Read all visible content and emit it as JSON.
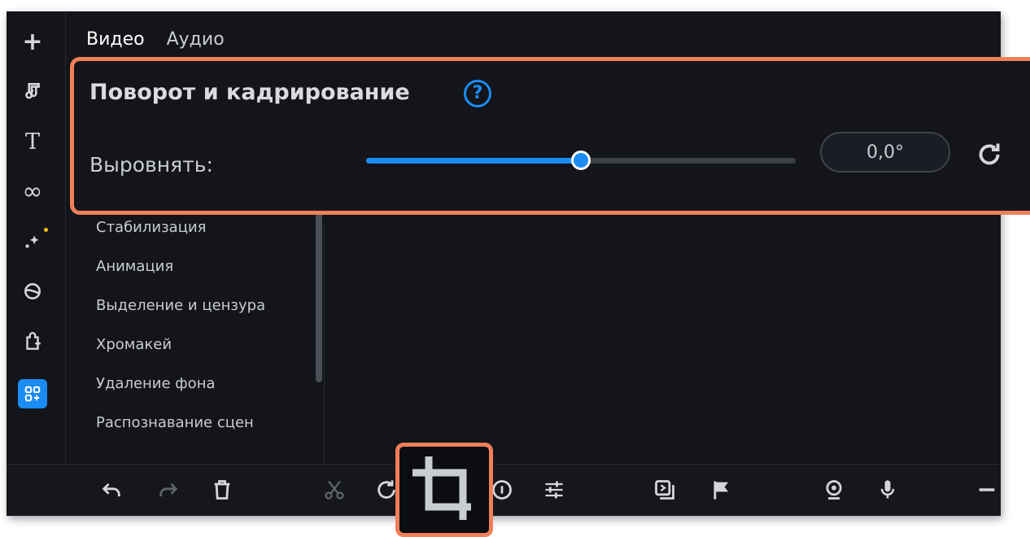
{
  "tabs": {
    "video": "Видео",
    "audio": "Аудио"
  },
  "panel": {
    "title": "Поворот и кадрирование",
    "help": "?",
    "align_label": "Выровнять:",
    "slider_level": 0.5,
    "value": "0,0°"
  },
  "categories": [
    "Стабилизация",
    "Анимация",
    "Выделение и цензура",
    "Хромакей",
    "Удаление фона",
    "Распознавание сцен"
  ],
  "sidebar_icons": [
    "plus-icon",
    "music-icon",
    "text-icon",
    "transitions-icon",
    "effects-icon",
    "filters-icon",
    "stickers-icon",
    "more-tools-icon"
  ],
  "toolbar_icons": [
    "undo-icon",
    "redo-icon",
    "delete-icon",
    "cut-icon",
    "rotate-icon",
    "crop-icon",
    "info-icon",
    "adjust-icon",
    "export-clip-icon",
    "marker-icon",
    "webcam-icon",
    "microphone-icon",
    "zoom-out-icon"
  ],
  "colors": {
    "accent": "#1b8cf3",
    "highlight": "#f07f5a",
    "background": "#13151a"
  }
}
